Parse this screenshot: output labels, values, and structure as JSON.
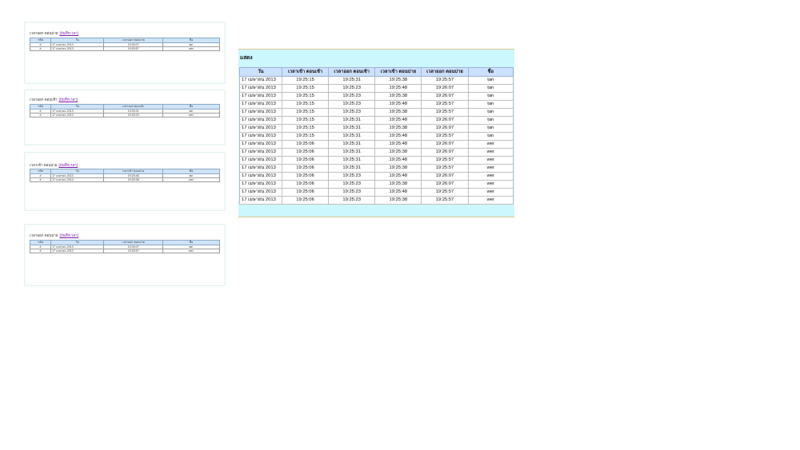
{
  "panels": [
    {
      "title": "เวลาออก ตอนบ่าย",
      "link": "[บันทึกเวลา]",
      "headers": [
        "รหัส",
        "วัน",
        "เวลาออก ตอนบ่าย",
        "ชื่อ"
      ],
      "rows": [
        [
          "#",
          "17 เมษายน 2013",
          "19:26:07",
          "tan"
        ],
        [
          "#",
          "17 เมษายน 2013",
          "19:25:57",
          "wer"
        ]
      ]
    },
    {
      "title": "เวลาออก ตอนเช้า",
      "link": "[บันทึกเวลา]",
      "headers": [
        "รหัส",
        "วัน",
        "เวลาออก ตอนเช้า",
        "ชื่อ"
      ],
      "rows": [
        [
          "#",
          "17 เมษายน 2013",
          "19:25:31",
          "tan"
        ],
        [
          "#",
          "17 เมษายน 2013",
          "19:25:23",
          "wer"
        ]
      ]
    },
    {
      "title": "เวลาเข้า ตอนบ่าย",
      "link": "[บันทึกเวลา]",
      "headers": [
        "รหัส",
        "วัน",
        "เวลาเข้า ตอนบ่าย",
        "ชื่อ"
      ],
      "rows": [
        [
          "#",
          "17 เมษายน 2013",
          "19:25:48",
          "tan"
        ],
        [
          "#",
          "17 เมษายน 2013",
          "19:25:38",
          "wer"
        ]
      ]
    },
    {
      "title": "เวลาออก ตอนบ่าย",
      "link": "[บันทึกเวลา]",
      "headers": [
        "รหัส",
        "วัน",
        "เวลาออก ตอนบ่าย",
        "ชื่อ"
      ],
      "rows": [
        [
          "#",
          "17 เมษายน 2013",
          "19:26:07",
          "tan"
        ],
        [
          "#",
          "17 เมษายน 2013",
          "19:25:57",
          "wer"
        ]
      ]
    }
  ],
  "main": {
    "title": "แสดง",
    "headers": [
      "วัน",
      "เวลาเข้า ตอนเช้า",
      "เวลาออก ตอนเช้า",
      "เวลาเข้า ตอนบ่าย",
      "เวลาออก ตอนบ่าย",
      "ชื่อ"
    ],
    "rows": [
      [
        "17 เมษายน 2013",
        "19:25:15",
        "19:25:31",
        "19:25:38",
        "19:25:57",
        "tan"
      ],
      [
        "17 เมษายน 2013",
        "19:25:15",
        "19:25:23",
        "19:25:48",
        "19:26:07",
        "tan"
      ],
      [
        "17 เมษายน 2013",
        "19:25:15",
        "19:25:23",
        "19:25:38",
        "19:26:07",
        "tan"
      ],
      [
        "17 เมษายน 2013",
        "19:25:15",
        "19:25:23",
        "19:25:48",
        "19:25:57",
        "tan"
      ],
      [
        "17 เมษายน 2013",
        "19:25:15",
        "19:25:23",
        "19:25:38",
        "19:25:57",
        "tan"
      ],
      [
        "17 เมษายน 2013",
        "19:25:15",
        "19:25:31",
        "19:25:48",
        "19:26:07",
        "tan"
      ],
      [
        "17 เมษายน 2013",
        "19:25:15",
        "19:25:31",
        "19:25:38",
        "19:26:07",
        "tan"
      ],
      [
        "17 เมษายน 2013",
        "19:25:15",
        "19:25:31",
        "19:25:48",
        "19:25:57",
        "tan"
      ],
      [
        "17 เมษายน 2013",
        "19:25:06",
        "19:25:31",
        "19:25:48",
        "19:26:07",
        "wer"
      ],
      [
        "17 เมษายน 2013",
        "19:25:06",
        "19:25:31",
        "19:25:38",
        "19:26:07",
        "wer"
      ],
      [
        "17 เมษายน 2013",
        "19:25:06",
        "19:25:31",
        "19:25:48",
        "19:25:57",
        "wer"
      ],
      [
        "17 เมษายน 2013",
        "19:25:06",
        "19:25:31",
        "19:25:38",
        "19:25:57",
        "wer"
      ],
      [
        "17 เมษายน 2013",
        "19:25:06",
        "19:25:23",
        "19:25:48",
        "19:26:07",
        "wer"
      ],
      [
        "17 เมษายน 2013",
        "19:25:06",
        "19:25:23",
        "19:25:38",
        "19:26:07",
        "wer"
      ],
      [
        "17 เมษายน 2013",
        "19:25:06",
        "19:25:23",
        "19:25:48",
        "19:25:57",
        "wer"
      ],
      [
        "17 เมษายน 2013",
        "19:25:06",
        "19:25:23",
        "19:25:38",
        "19:25:57",
        "wer"
      ]
    ]
  },
  "colors": {
    "main_background": "#ccf7fd",
    "table_header": "#cce0ff",
    "link": "#7a1aa6"
  }
}
